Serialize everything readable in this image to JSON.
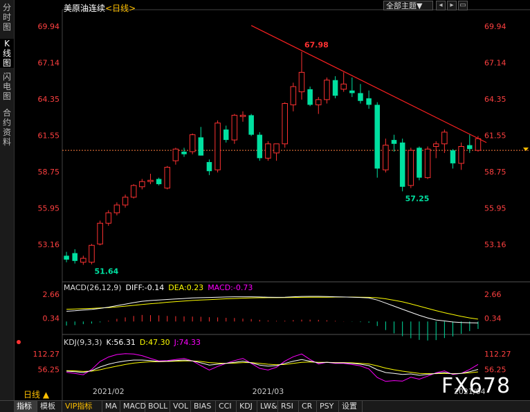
{
  "sidebar": {
    "tabs": [
      {
        "label": "分时图",
        "active": false
      },
      {
        "label": "K线图",
        "active": true
      },
      {
        "label": "闪电图",
        "active": false
      },
      {
        "label": "合约资料",
        "active": false
      }
    ]
  },
  "header": {
    "title": "美原油连续",
    "period": "<日线>",
    "theme_select": "全部主题▼",
    "buttons": [
      "◂",
      "▸",
      "▭"
    ]
  },
  "colors": {
    "up": "#ff3232",
    "down": "#00e0a0",
    "trend": "#ff2020",
    "diff": "#ffffff",
    "dea": "#ffff00",
    "macd": "#ff00ff",
    "k": "#ffffff",
    "d": "#ffff00",
    "j": "#ff00ff",
    "axis_text": "#ff4040",
    "current": "#ff8040"
  },
  "macd_title": {
    "name": "MACD(26,12,9)",
    "diff": "DIFF:-0.14",
    "dea": "DEA:0.23",
    "macd": "MACD:-0.73"
  },
  "kdj_title": {
    "name": "KDJ(9,3,3)",
    "k": "K:56.31",
    "d": "D:47.30",
    "j": "J:74.33"
  },
  "period_label": "日线 ▲",
  "watermark": "FX678",
  "toolbar": {
    "items": [
      "指标",
      "模板",
      "VIP指标",
      "MA",
      "MACD",
      "BOLL",
      "VOL",
      "BIAS",
      "CCI",
      "KDJ",
      "LW&",
      "RSI",
      "CR",
      "PSY",
      "设置"
    ]
  },
  "chart_data": {
    "type": "candlestick",
    "title": "美原油连续 <日线>",
    "ylim": [
      50.4,
      71.0
    ],
    "y_ticks": [
      "69.94",
      "67.14",
      "64.35",
      "61.55",
      "58.75",
      "55.95",
      "53.16"
    ],
    "y_tick_values": [
      69.94,
      67.14,
      64.35,
      61.55,
      58.75,
      55.95,
      53.16
    ],
    "x_labels": [
      {
        "label": "2021/02",
        "index": 5
      },
      {
        "label": "2021/03",
        "index": 24
      },
      {
        "label": "2021/04",
        "index": 48
      }
    ],
    "current_price": 60.4,
    "annotations": [
      {
        "label": "67.98",
        "index": 28,
        "value": 67.98
      },
      {
        "label": "57.25",
        "index": 40,
        "value": 57.25
      },
      {
        "label": "51.64",
        "index": 3,
        "value": 51.64
      }
    ],
    "trendline": {
      "from": {
        "index": 22,
        "value": 70.0
      },
      "to": {
        "index": 50,
        "value": 61.0
      }
    },
    "ohlc": [
      [
        52.3,
        52.6,
        51.8,
        52.0
      ],
      [
        52.5,
        52.8,
        51.7,
        51.9
      ],
      [
        51.8,
        52.3,
        51.6,
        52.1
      ],
      [
        51.8,
        53.2,
        51.64,
        53.1
      ],
      [
        53.2,
        55.0,
        53.1,
        54.8
      ],
      [
        54.8,
        55.8,
        54.6,
        55.6
      ],
      [
        55.6,
        56.4,
        55.4,
        56.2
      ],
      [
        56.2,
        57.0,
        56.0,
        56.8
      ],
      [
        56.8,
        57.8,
        56.7,
        57.7
      ],
      [
        57.6,
        58.2,
        57.4,
        58.0
      ],
      [
        58.0,
        58.6,
        57.8,
        58.1
      ],
      [
        58.2,
        58.3,
        57.7,
        57.8
      ],
      [
        57.5,
        59.2,
        57.4,
        59.1
      ],
      [
        59.6,
        60.6,
        59.3,
        60.5
      ],
      [
        60.3,
        60.6,
        59.9,
        60.1
      ],
      [
        60.3,
        61.7,
        60.1,
        61.6
      ],
      [
        61.4,
        62.2,
        60.0,
        60.0
      ],
      [
        59.5,
        59.7,
        58.5,
        58.8
      ],
      [
        58.9,
        62.7,
        58.7,
        62.5
      ],
      [
        62.0,
        62.3,
        61.0,
        61.2
      ],
      [
        61.2,
        63.2,
        60.9,
        63.1
      ],
      [
        63.0,
        63.4,
        62.6,
        63.1
      ],
      [
        63.1,
        63.2,
        61.5,
        61.6
      ],
      [
        61.6,
        61.8,
        59.6,
        59.8
      ],
      [
        59.8,
        61.1,
        59.6,
        60.9
      ],
      [
        60.2,
        60.8,
        59.6,
        60.9
      ],
      [
        60.9,
        64.1,
        60.6,
        64.0
      ],
      [
        63.9,
        65.6,
        63.4,
        65.3
      ],
      [
        64.9,
        67.98,
        64.3,
        66.4
      ],
      [
        65.1,
        65.3,
        63.8,
        63.9
      ],
      [
        63.9,
        64.5,
        63.2,
        64.3
      ],
      [
        64.3,
        66.0,
        64.0,
        65.8
      ],
      [
        65.8,
        66.1,
        64.4,
        64.6
      ],
      [
        65.1,
        66.4,
        64.9,
        65.5
      ],
      [
        65.0,
        66.0,
        64.5,
        64.8
      ],
      [
        64.8,
        65.5,
        64.0,
        64.2
      ],
      [
        64.4,
        65.0,
        63.6,
        63.9
      ],
      [
        63.9,
        64.1,
        58.3,
        59.0
      ],
      [
        58.9,
        61.3,
        58.7,
        60.8
      ],
      [
        61.2,
        61.6,
        60.3,
        60.9
      ],
      [
        61.0,
        61.3,
        57.25,
        57.6
      ],
      [
        57.7,
        60.6,
        57.5,
        60.4
      ],
      [
        60.6,
        60.7,
        58.1,
        58.3
      ],
      [
        58.3,
        60.7,
        58.2,
        60.5
      ],
      [
        60.7,
        61.1,
        59.8,
        60.9
      ],
      [
        60.9,
        62.0,
        60.2,
        61.8
      ],
      [
        60.4,
        60.5,
        59.0,
        59.4
      ],
      [
        59.4,
        61.0,
        58.9,
        60.7
      ],
      [
        60.8,
        61.6,
        60.2,
        60.5
      ],
      [
        60.4,
        61.5,
        60.3,
        61.3
      ]
    ],
    "macd": {
      "ylim": [
        -1.2,
        3.0
      ],
      "y_ticks": [
        "2.66",
        "0.34"
      ],
      "y_tick_values": [
        2.66,
        0.34
      ],
      "diff": [
        1.0,
        1.05,
        1.12,
        1.18,
        1.28,
        1.4,
        1.55,
        1.7,
        1.85,
        1.98,
        2.05,
        2.1,
        2.15,
        2.2,
        2.25,
        2.3,
        2.33,
        2.35,
        2.38,
        2.4,
        2.42,
        2.42,
        2.42,
        2.4,
        2.38,
        2.36,
        2.38,
        2.42,
        2.45,
        2.46,
        2.46,
        2.44,
        2.42,
        2.4,
        2.38,
        2.35,
        2.3,
        2.1,
        1.8,
        1.5,
        1.2,
        0.9,
        0.6,
        0.35,
        0.15,
        0.05,
        -0.05,
        -0.1,
        -0.12,
        -0.14
      ],
      "dea": [
        1.2,
        1.22,
        1.25,
        1.28,
        1.32,
        1.36,
        1.42,
        1.5,
        1.58,
        1.66,
        1.74,
        1.8,
        1.88,
        1.94,
        2.0,
        2.06,
        2.1,
        2.14,
        2.18,
        2.22,
        2.25,
        2.28,
        2.3,
        2.32,
        2.33,
        2.33,
        2.34,
        2.35,
        2.36,
        2.37,
        2.38,
        2.38,
        2.39,
        2.39,
        2.39,
        2.38,
        2.36,
        2.32,
        2.22,
        2.08,
        1.92,
        1.72,
        1.5,
        1.28,
        1.06,
        0.86,
        0.68,
        0.5,
        0.35,
        0.23
      ],
      "macd": [
        -0.4,
        -0.35,
        -0.26,
        -0.2,
        -0.08,
        0.08,
        0.26,
        0.4,
        0.54,
        0.64,
        0.62,
        0.6,
        0.54,
        0.52,
        0.5,
        0.48,
        0.46,
        0.42,
        0.4,
        0.36,
        0.34,
        0.28,
        0.24,
        0.16,
        0.1,
        0.06,
        0.08,
        0.14,
        0.18,
        0.18,
        0.16,
        0.12,
        0.06,
        0.02,
        -0.02,
        -0.06,
        -0.12,
        -0.44,
        -0.84,
        -1.16,
        -1.44,
        -1.64,
        -1.8,
        -1.86,
        -1.82,
        -1.62,
        -1.46,
        -1.2,
        -0.94,
        -0.73
      ]
    },
    "kdj": {
      "ylim": [
        0,
        140
      ],
      "y_ticks": [
        "112.27",
        "56.25"
      ],
      "y_tick_values": [
        112.27,
        56.25
      ],
      "k": [
        50,
        48,
        45,
        52,
        65,
        75,
        82,
        87,
        90,
        90,
        88,
        85,
        86,
        88,
        90,
        87,
        80,
        72,
        75,
        78,
        82,
        86,
        80,
        72,
        68,
        70,
        78,
        86,
        92,
        86,
        80,
        82,
        80,
        80,
        78,
        75,
        70,
        55,
        45,
        42,
        38,
        40,
        35,
        38,
        42,
        45,
        40,
        42,
        48,
        56.31
      ],
      "d": [
        52,
        51,
        49,
        50,
        55,
        62,
        68,
        74,
        79,
        82,
        84,
        84,
        85,
        86,
        87,
        87,
        85,
        81,
        79,
        78,
        79,
        81,
        81,
        78,
        75,
        73,
        74,
        78,
        82,
        83,
        82,
        82,
        81,
        81,
        80,
        78,
        76,
        69,
        61,
        55,
        50,
        46,
        42,
        41,
        41,
        42,
        41,
        42,
        44,
        47.3
      ],
      "j": [
        46,
        42,
        37,
        56,
        85,
        101,
        110,
        113,
        112,
        106,
        96,
        87,
        88,
        92,
        96,
        87,
        70,
        54,
        67,
        78,
        88,
        96,
        78,
        60,
        54,
        64,
        86,
        102,
        112,
        92,
        76,
        82,
        78,
        78,
        74,
        69,
        58,
        27,
        13,
        16,
        14,
        28,
        21,
        32,
        44,
        51,
        38,
        42,
        56,
        74.33
      ]
    }
  }
}
